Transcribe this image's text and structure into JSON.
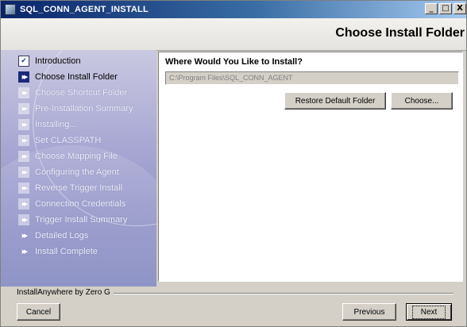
{
  "window": {
    "title": "SQL_CONN_AGENT_INSTALL",
    "minimize": "_",
    "maximize": "□",
    "close": "X"
  },
  "header": {
    "title": "Choose Install Folder"
  },
  "steps": [
    {
      "label": "Introduction",
      "state": "done"
    },
    {
      "label": "Choose Install Folder",
      "state": "current"
    },
    {
      "label": "Choose Shortcut Folder",
      "state": "future"
    },
    {
      "label": "Pre-Installation Summary",
      "state": "future"
    },
    {
      "label": "Installing...",
      "state": "future"
    },
    {
      "label": "Set CLASSPATH",
      "state": "future"
    },
    {
      "label": "Choose Mapping File",
      "state": "future"
    },
    {
      "label": "Configuring the Agent",
      "state": "future"
    },
    {
      "label": "Reverse Trigger Install",
      "state": "future"
    },
    {
      "label": "Connection Credentials",
      "state": "future"
    },
    {
      "label": "Trigger Install Summary",
      "state": "future"
    },
    {
      "label": "Detailed Logs",
      "state": "future"
    },
    {
      "label": "Install Complete",
      "state": "future"
    }
  ],
  "main": {
    "question": "Where Would You Like to Install?",
    "install_path": "C:\\Program Files\\SQL_CONN_AGENT",
    "restore_label": "Restore Default Folder",
    "choose_label": "Choose..."
  },
  "footer": {
    "vendor": "InstallAnywhere by Zero G",
    "cancel_label": "Cancel",
    "previous_label": "Previous",
    "next_label": "Next"
  },
  "icons": {
    "done": "check-icon",
    "current": "double-arrow-icon",
    "future": "double-arrow-icon"
  }
}
